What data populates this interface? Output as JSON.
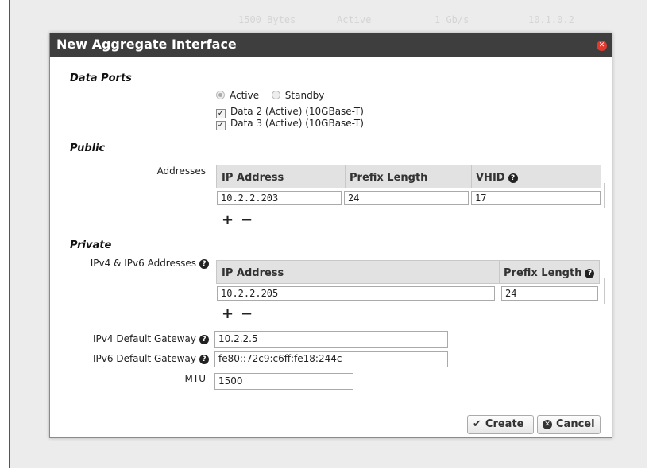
{
  "background_row": [
    "1500 Bytes",
    "Active",
    "1 Gb/s",
    "10.1.0.2"
  ],
  "dialog": {
    "title": "New Aggregate Interface",
    "close_icon": "close-icon"
  },
  "data_ports": {
    "heading": "Data Ports",
    "radio_active": "Active",
    "radio_standby": "Standby",
    "ports": [
      "Data 2 (Active) (10GBase-T)",
      "Data 3 (Active) (10GBase-T)"
    ]
  },
  "public": {
    "heading": "Public",
    "addresses_label": "Addresses",
    "columns": [
      "IP Address",
      "Prefix Length",
      "VHID"
    ],
    "rows": [
      {
        "ip": "10.2.2.203",
        "prefix": "24",
        "vhid": "17"
      }
    ],
    "add": "+",
    "remove": "−"
  },
  "private": {
    "heading": "Private",
    "addresses_label": "IPv4 & IPv6 Addresses",
    "columns": [
      "IP Address",
      "Prefix Length"
    ],
    "rows": [
      {
        "ip": "10.2.2.205",
        "prefix": "24"
      }
    ],
    "add": "+",
    "remove": "−",
    "ipv4_gateway_label": "IPv4 Default Gateway",
    "ipv4_gateway_value": "10.2.2.5",
    "ipv6_gateway_label": "IPv6 Default Gateway",
    "ipv6_gateway_value": "fe80::72c9:c6ff:fe18:244c",
    "mtu_label": "MTU",
    "mtu_value": "1500"
  },
  "buttons": {
    "create": "Create",
    "cancel": "Cancel"
  },
  "colors": {
    "titlebar": "#3e3e3e",
    "close": "#e03a2f"
  }
}
